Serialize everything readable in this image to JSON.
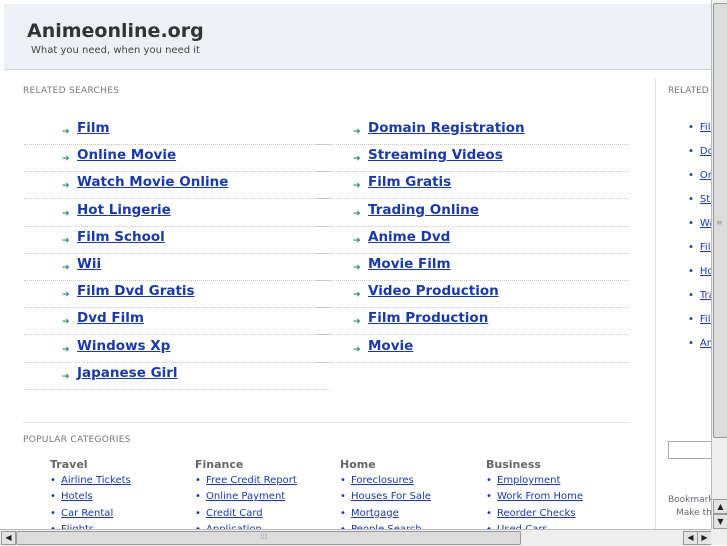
{
  "header": {
    "title": "Animeonline.org",
    "tagline": "What you need, when you need it"
  },
  "related": {
    "label": "RELATED SEARCHES",
    "left": [
      "Film",
      "Online Movie",
      "Watch Movie Online",
      "Hot Lingerie",
      "Film School",
      "Wii",
      "Film Dvd Gratis",
      "Dvd Film",
      "Windows Xp",
      "Japanese Girl"
    ],
    "right": [
      "Domain Registration",
      "Streaming Videos",
      "Film Gratis",
      "Trading Online",
      "Anime Dvd",
      "Movie Film",
      "Video Production",
      "Film Production",
      "Movie"
    ]
  },
  "side_panel": {
    "label": "RELATED",
    "items": [
      "Film",
      "Do",
      "Or",
      "Str",
      "Wa",
      "Film",
      "Ho",
      "Tra",
      "Film",
      "An"
    ],
    "bookmark": "Bookmark",
    "make_this": "Make thi"
  },
  "popular": {
    "label": "POPULAR CATEGORIES",
    "columns": [
      {
        "heading": "Travel",
        "items": [
          "Airline Tickets",
          "Hotels",
          "Car Rental",
          "Flights"
        ]
      },
      {
        "heading": "Finance",
        "items": [
          "Free Credit Report",
          "Online Payment",
          "Credit Card",
          "Application"
        ]
      },
      {
        "heading": "Home",
        "items": [
          "Foreclosures",
          "Houses For Sale",
          "Mortgage",
          "People Search"
        ]
      },
      {
        "heading": "Business",
        "items": [
          "Employment",
          "Work From Home",
          "Reorder Checks",
          "Used Cars"
        ]
      }
    ]
  },
  "icons": {
    "bullet": "arrow-bullet-icon",
    "scroll_up": "scroll-up-arrow-icon",
    "scroll_down": "scroll-down-arrow-icon",
    "scroll_left": "scroll-left-arrow-icon",
    "scroll_right": "scroll-right-arrow-icon"
  },
  "colors": {
    "link": "#1a3aa8",
    "header_bg": "#edf1f5",
    "bullet": "#2a8a6a"
  }
}
